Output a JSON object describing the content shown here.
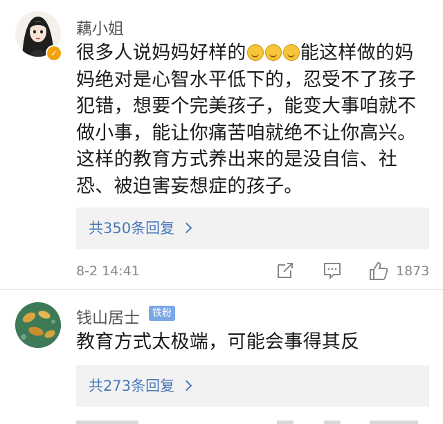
{
  "comments": [
    {
      "username": "藕小姐",
      "verified": true,
      "text_line1_before_emoji": "很多人说妈妈好样的",
      "emoji_name": "laughing-tears-emoji",
      "emoji_count": 3,
      "text_line1_after_emoji": "能这样做的",
      "text_rest": "妈妈绝对是心智水平低下的，忍受不了孩子犯错，想要个完美孩子，能变大事咱就不做小事，能让你痛苦咱就绝不让你高兴。这样的教育方式养出来的是没自信、社恐、被迫害妄想症的孩子。",
      "reply_label": "共350条回复",
      "time": "8-2 14:41",
      "likes": "1873",
      "avatar_color": "#f4f1ec",
      "badge_color": "#f2a20c"
    },
    {
      "username": "钱山居士",
      "fan_badge": "铁粉",
      "text": "教育方式太极端，可能会事得其反",
      "reply_label": "共273条回复",
      "avatar_color": "#3f7a58",
      "fan_badge_color": "#7aa7e6"
    }
  ],
  "colors": {
    "link": "#4a77b8",
    "reply_bg": "#f2f2f2",
    "meta_text": "#888888"
  },
  "icons": [
    "share-icon",
    "comment-icon",
    "like-icon"
  ]
}
